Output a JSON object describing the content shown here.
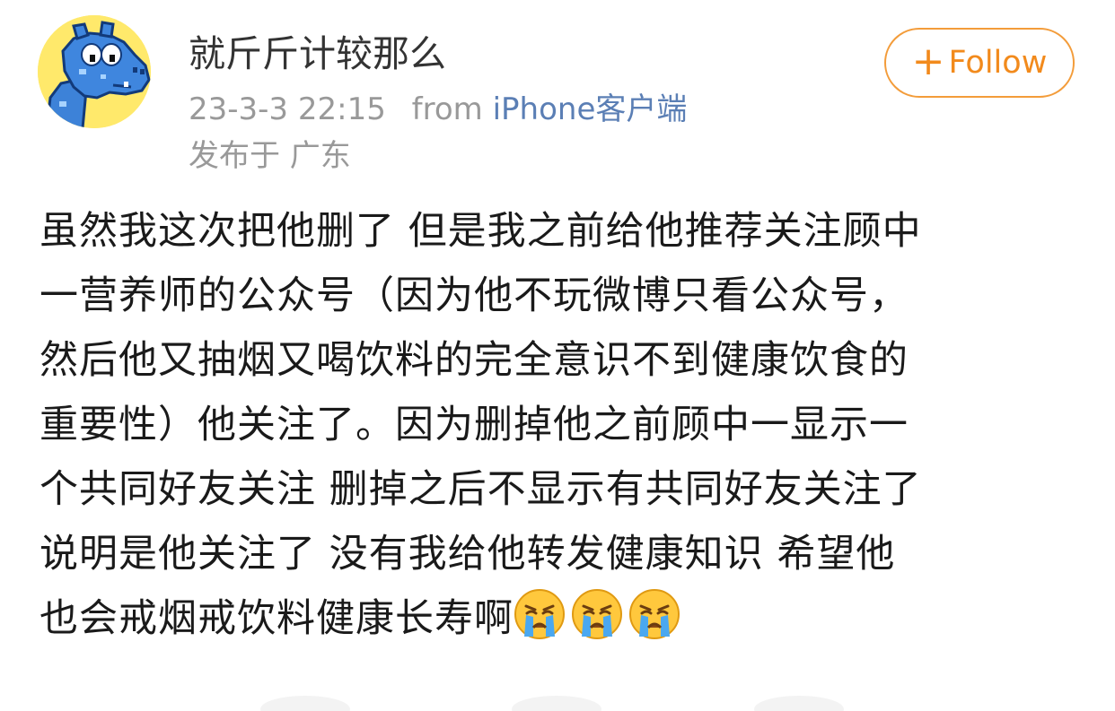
{
  "post": {
    "author": "就斤斤计较那么",
    "time": "23-3-3 22:15",
    "source_prefix": "from",
    "device": "iPhone客户端",
    "location": "发布于 广东",
    "follow_label": "Follow",
    "follow_icon": "plus-icon",
    "avatar_icon": "blue-hippo-avatar",
    "text_line1": "虽然我这次把他删了 但是我之前给他推荐关注顾中",
    "text_line2": "一营养师的公众号（因为他不玩微博只看公众号，",
    "text_line3": "然后他又抽烟又喝饮料的完全意识不到健康饮食的",
    "text_line4": "重要性）他关注了。因为删掉他之前顾中一显示一",
    "text_line5": "个共同好友关注 删掉之后不显示有共同好友关注了",
    "text_line6": "说明是他关注了 没有我给他转发健康知识 希望他",
    "text_line7": "也会戒烟戒饮料健康长寿啊",
    "emojis": [
      "crying-face-emoji",
      "crying-face-emoji",
      "crying-face-emoji"
    ]
  },
  "colors": {
    "follow_accent": "#f28a1c",
    "device_link": "#5b7fb5",
    "meta_gray": "#999999",
    "avatar_bg": "#ffe96b"
  }
}
